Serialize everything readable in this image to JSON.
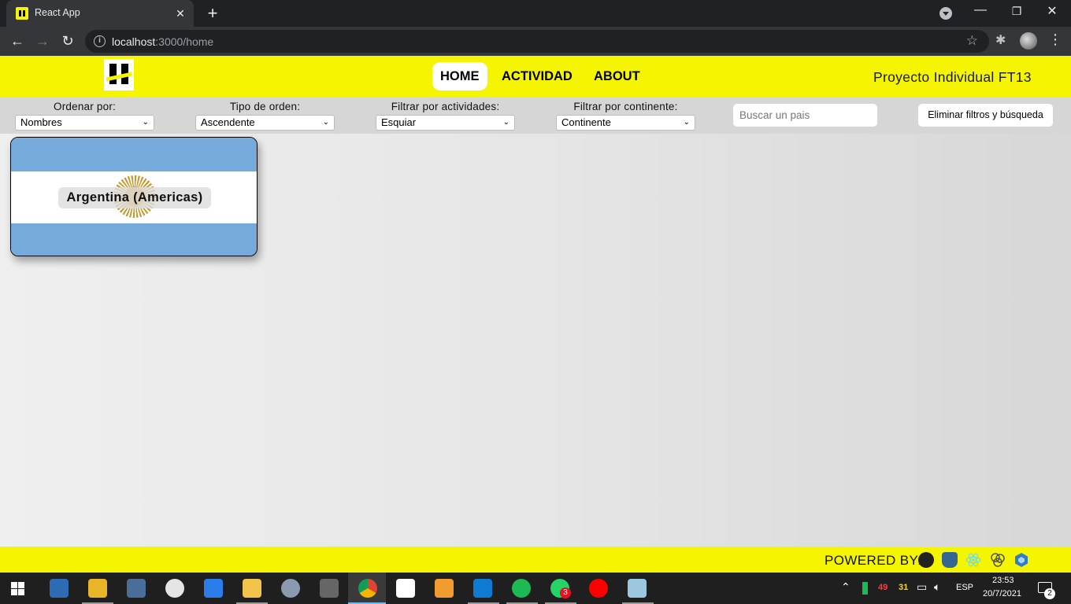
{
  "browser": {
    "tab_title": "React App",
    "tab_close": "✕",
    "new_tab": "+",
    "url_host": "localhost",
    "url_path": ":3000/home",
    "window_controls": {
      "minimize": "—",
      "restore": "❐",
      "close": "✕"
    },
    "icons": {
      "back": "←",
      "forward": "→",
      "reload": "↻",
      "info": "i",
      "star": "☆",
      "extensions": "✱",
      "menu": "⋮"
    }
  },
  "header": {
    "nav": [
      {
        "label": "HOME",
        "active": true
      },
      {
        "label": "ACTIVIDAD",
        "active": false
      },
      {
        "label": "ABOUT",
        "active": false
      }
    ],
    "project_title": "Proyecto Individual FT13",
    "brand_color": "#f5f500"
  },
  "filters": {
    "order_by": {
      "label": "Ordenar por:",
      "value": "Nombres"
    },
    "order_type": {
      "label": "Tipo de orden:",
      "value": "Ascendente"
    },
    "activity": {
      "label": "Filtrar por actividades:",
      "value": "Esquiar"
    },
    "continent": {
      "label": "Filtrar por continente:",
      "value": "Continente"
    },
    "search": {
      "placeholder": "Buscar un pais"
    },
    "clear_label": "Eliminar filtros y búsqueda",
    "chevron": "⌄"
  },
  "countries": [
    {
      "label": "Argentina (Americas)",
      "flag_colors": [
        "#75aadb",
        "#ffffff",
        "#75aadb"
      ]
    }
  ],
  "footer": {
    "powered_label": "POWERED BY:",
    "tech_icons": [
      "express-icon",
      "postgresql-icon",
      "react-icon",
      "redux-icon",
      "sequelize-icon"
    ]
  },
  "taskbar": {
    "tray": {
      "lang": "ESP",
      "time": "23:53",
      "date": "20/7/2021",
      "notifications": "2",
      "temp1": "49",
      "temp2": "31"
    },
    "whatsapp_badge": "3",
    "apps": [
      "task-view-icon",
      "file-explorer-icon",
      "calculator-icon",
      "clock-icon",
      "todo-icon",
      "sticky-notes-icon",
      "camera-icon",
      "radio-icon",
      "chrome-icon",
      "dl-icon",
      "sublime-icon",
      "vscode-icon",
      "spotify-icon",
      "whatsapp-icon",
      "youtube-music-icon",
      "notes-icon"
    ]
  }
}
